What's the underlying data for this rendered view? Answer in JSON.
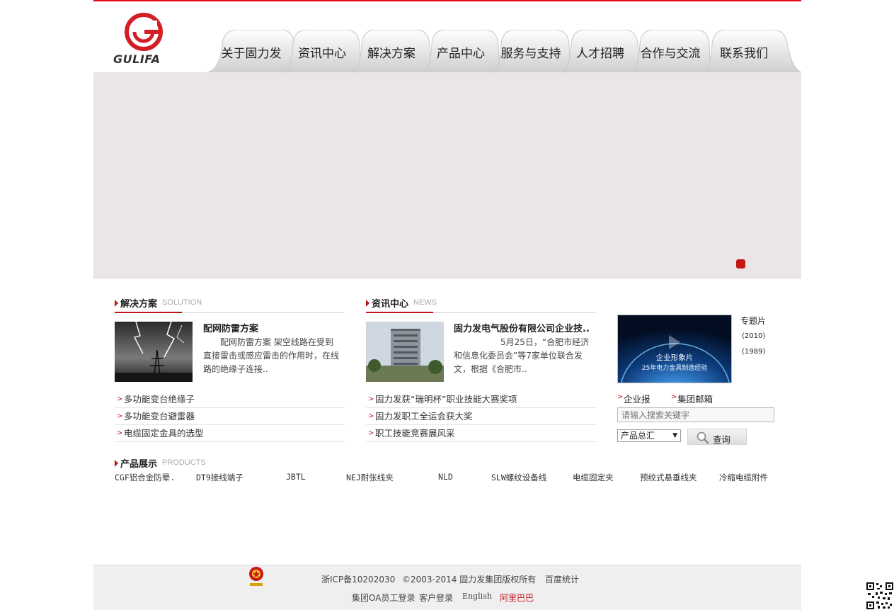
{
  "header": {
    "logo_text": "GULIFA",
    "nav": [
      "关于固力发",
      "资讯中心",
      "解决方案",
      "产品中心",
      "服务与支持",
      "人才招聘",
      "合作与交流",
      "联系我们"
    ]
  },
  "solution": {
    "title_cn": "解决方案",
    "title_en": "SOLUTION",
    "feature_title": "配网防雷方案",
    "feature_text": "配网防雷方案                架空线路在受到直接雷击或感应雷击的作用时，在线路的绝缘子连接..",
    "items": [
      "多功能变台绝缘子",
      "多功能变台避雷器",
      "电缆固定金具的选型"
    ]
  },
  "news": {
    "title_cn": "资讯中心",
    "title_en": "NEWS",
    "feature_title": "固力发电气股份有限公司企业技..",
    "feature_text": "5月25日，“合肥市经济和信息化委员会”等7家单位联合发文，根据《合肥市..",
    "items": [
      "固力发获“瑞明杯”职业技能大赛奖项",
      "固力发职工全运会获大奖",
      "职工技能竞赛展风采"
    ]
  },
  "sidebar": {
    "video_caption": "企业形象片",
    "video_sub": "25年电力金具制造经验",
    "film_links": [
      "专题片",
      "(2010)",
      "(1989)"
    ],
    "quick_links": [
      "企业报",
      "集团邮箱"
    ],
    "search_placeholder": "请输入搜索关键字",
    "select_value": "产品总汇",
    "search_button": "查询"
  },
  "products": {
    "title_cn": "产品展示",
    "title_en": "PRODUCTS",
    "items": [
      "CGF铝合金防晕.",
      "DT9接线端子",
      "JBTL",
      "NEJ耐张线夹",
      "NLD",
      "SLW螺纹设备线",
      "电缆固定夹",
      "预绞式悬垂线夹",
      "冷缩电缆附件"
    ]
  },
  "footer": {
    "icp": "浙ICP备10202030",
    "copyright": "©2003-2014 固力发集团版权所有",
    "stats": "百度统计",
    "links": [
      "集团OA员工登录",
      "客户登录",
      "English",
      "阿里巴巴"
    ]
  },
  "colors": {
    "brand_red": "#c0141b",
    "top_line": "#e10a1a",
    "banner_bg": "#ebe6e5",
    "footer_bg": "#efefef"
  }
}
